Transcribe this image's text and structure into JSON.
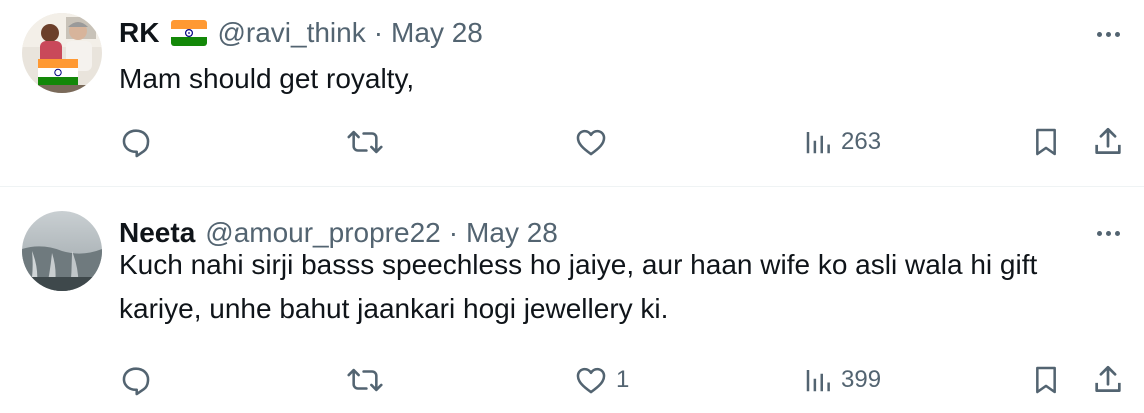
{
  "tweets": [
    {
      "display_name": "RK",
      "has_flag": true,
      "handle": "@ravi_think",
      "separator": "·",
      "date": "May 28",
      "text": "Mam should get royalty,",
      "reply_count": "",
      "retweet_count": "",
      "like_count": "",
      "views": "263"
    },
    {
      "display_name": "Neeta",
      "has_flag": false,
      "handle": "@amour_propre22",
      "separator": "·",
      "date": "May 28",
      "text": "Kuch nahi sirji basss speechless ho jaiye, aur haan wife ko asli wala hi gift kariye, unhe bahut jaankari hogi jewellery ki.",
      "reply_count": "",
      "retweet_count": "",
      "like_count": "1",
      "views": "399"
    }
  ],
  "icons": {
    "reply": "reply-icon",
    "retweet": "retweet-icon",
    "like": "heart-icon",
    "views": "views-icon",
    "bookmark": "bookmark-icon",
    "share": "share-icon",
    "more": "more-icon",
    "flag": "india-flag-icon"
  },
  "colors": {
    "text_primary": "#0f1419",
    "text_secondary": "#536471",
    "divider": "#eff3f4"
  }
}
